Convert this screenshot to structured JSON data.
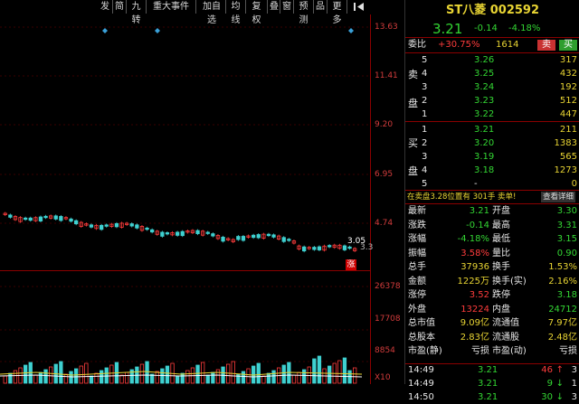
{
  "toolbar": {
    "items": [
      "发",
      "简",
      "九转",
      "重大事件",
      "加自选",
      "均线",
      "复权",
      "叠",
      "窗",
      "预测",
      "品",
      "更多"
    ],
    "pin_icon": "pin-icon"
  },
  "chart": {
    "price_axis": [
      "13.63",
      "11.41",
      "9.20",
      "6.95",
      "4.74"
    ],
    "volume_axis": [
      "26378",
      "17708",
      "8854",
      "X10"
    ],
    "last_price_label": "3.05",
    "right_edge_label": "3.3",
    "zhang_badge": "涨",
    "marker_color": "#3aa0d8"
  },
  "quote": {
    "name": "ST八菱",
    "code": "002592",
    "price": "3.21",
    "change": "-0.14",
    "change_pct": "-4.18%",
    "weibi_label": "委比",
    "weibi_value": "+30.75%",
    "weibi_qty": "1614",
    "sell_btn": "卖",
    "buy_btn": "买",
    "sell_side_labels": [
      "卖",
      "盘"
    ],
    "buy_side_labels": [
      "买",
      "盘"
    ],
    "asks": [
      {
        "level": "5",
        "price": "3.26",
        "vol": "317"
      },
      {
        "level": "4",
        "price": "3.25",
        "vol": "432"
      },
      {
        "level": "3",
        "price": "3.24",
        "vol": "192"
      },
      {
        "level": "2",
        "price": "3.23",
        "vol": "512"
      },
      {
        "level": "1",
        "price": "3.22",
        "vol": "447"
      }
    ],
    "bids": [
      {
        "level": "1",
        "price": "3.21",
        "vol": "211"
      },
      {
        "level": "2",
        "price": "3.20",
        "vol": "1383"
      },
      {
        "level": "3",
        "price": "3.19",
        "vol": "565"
      },
      {
        "level": "4",
        "price": "3.18",
        "vol": "1273"
      },
      {
        "level": "5",
        "price": "-",
        "vol": "0"
      }
    ],
    "notice": "在卖盘3.28位置有 301手 卖单!",
    "detail_link": "查看详细",
    "stats": [
      {
        "l1": "最新",
        "v1": "3.21",
        "l2": "开盘",
        "v2": "3.30"
      },
      {
        "l1": "涨跌",
        "v1": "-0.14",
        "l2": "最高",
        "v2": "3.31"
      },
      {
        "l1": "涨幅",
        "v1": "-4.18%",
        "l2": "最低",
        "v2": "3.15"
      },
      {
        "l1": "振幅",
        "v1": "3.58%",
        "l2": "量比",
        "v2": "0.90"
      },
      {
        "l1": "总手",
        "v1": "37936",
        "l2": "换手",
        "v2": "1.53%"
      },
      {
        "l1": "金额",
        "v1": "1225万",
        "l2": "换手(实)",
        "v2": "2.16%"
      },
      {
        "l1": "涨停",
        "v1": "3.52",
        "l2": "跌停",
        "v2": "3.18"
      },
      {
        "l1": "外盘",
        "v1": "13224",
        "l2": "内盘",
        "v2": "24712"
      },
      {
        "l1": "总市值",
        "v1": "9.09亿",
        "l2": "流通值",
        "v2": "7.97亿"
      },
      {
        "l1": "总股本",
        "v1": "2.83亿",
        "l2": "流通股",
        "v2": "2.48亿"
      },
      {
        "l1": "市盈(静)",
        "v1": "亏损",
        "l2": "市盈(动)",
        "v2": "亏损"
      }
    ],
    "ticks": [
      {
        "time": "14:49",
        "price": "3.21",
        "vol": "46",
        "dir": "up",
        "n": "3"
      },
      {
        "time": "14:49",
        "price": "3.21",
        "vol": "9",
        "dir": "down",
        "n": "1"
      },
      {
        "time": "14:50",
        "price": "3.21",
        "vol": "30",
        "dir": "down",
        "n": "3"
      }
    ]
  }
}
